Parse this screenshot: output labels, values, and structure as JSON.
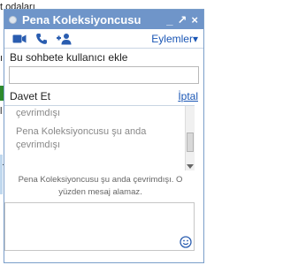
{
  "background": {
    "text_rows": [
      "t odaları",
      "ı",
      "l",
      "h"
    ]
  },
  "chat": {
    "title": "Pena Koleksiyoncusu",
    "controls": [
      "_",
      "↗",
      "×"
    ],
    "toolbar": {
      "icons": [
        "video-icon",
        "phone-icon",
        "add-person-icon"
      ],
      "actions_label": "Eylemler▾"
    },
    "add_to_chat_label": "Bu sohbete kullanıcı ekle",
    "add_to_chat_value": "",
    "invite_label": "Davet Et",
    "cancel_label": "İptal",
    "messages": [
      "çevrimdışı",
      "Pena Koleksiyoncusu şu anda çevrimdışı"
    ],
    "offline_notice": "Pena Koleksiyoncusu şu anda çevrimdışı. O yüzden mesaj alamaz.",
    "compose_value": ""
  },
  "colors": {
    "titlebar": "#6f95c9",
    "link": "#1a56b5",
    "status_green": "#2d8a2d"
  }
}
